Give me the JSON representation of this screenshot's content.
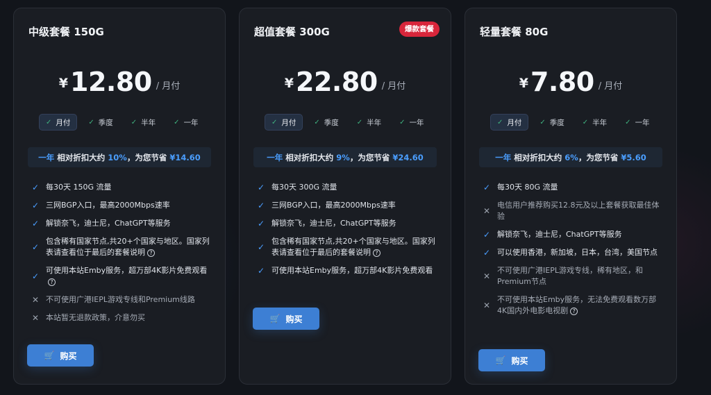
{
  "plans": [
    {
      "title": "中级套餐 150G",
      "badge": "",
      "currency": "¥",
      "price": "12.80",
      "unit": "/ 月付",
      "periods": [
        {
          "label": "月付",
          "active": true
        },
        {
          "label": "季度",
          "active": false
        },
        {
          "label": "半年",
          "active": false
        },
        {
          "label": "一年",
          "active": false
        }
      ],
      "discount": {
        "period": "一年",
        "text1": "相对折扣大约",
        "percent": "10%",
        "text2": "，为您节省",
        "amount": "¥14.60"
      },
      "features": [
        {
          "ok": true,
          "text": "每30天 150G 流量"
        },
        {
          "ok": true,
          "text": "三网BGP入口，最高2000Mbps速率"
        },
        {
          "ok": true,
          "text": "解锁奈飞，迪士尼，ChatGPT等服务"
        },
        {
          "ok": true,
          "text": "包含稀有国家节点,共20+个国家与地区。国家列表请查看位于最后的套餐说明",
          "help": true
        },
        {
          "ok": true,
          "text": "可使用本站Emby服务，超万部4K影片免费观看",
          "help": true
        },
        {
          "ok": false,
          "text": "不可使用广港IEPL游戏专线和Premium线路"
        },
        {
          "ok": false,
          "text": "本站暂无退款政策，介意勿买"
        }
      ],
      "buy_label": "购买"
    },
    {
      "title": "超值套餐 300G",
      "badge": "爆款套餐",
      "currency": "¥",
      "price": "22.80",
      "unit": "/ 月付",
      "periods": [
        {
          "label": "月付",
          "active": true
        },
        {
          "label": "季度",
          "active": false
        },
        {
          "label": "半年",
          "active": false
        },
        {
          "label": "一年",
          "active": false
        }
      ],
      "discount": {
        "period": "一年",
        "text1": "相对折扣大约",
        "percent": "9%",
        "text2": "，为您节省",
        "amount": "¥24.60"
      },
      "features": [
        {
          "ok": true,
          "text": "每30天 300G 流量"
        },
        {
          "ok": true,
          "text": "三网BGP入口，最高2000Mbps速率"
        },
        {
          "ok": true,
          "text": "解锁奈飞，迪士尼，ChatGPT等服务"
        },
        {
          "ok": true,
          "text": "包含稀有国家节点,共20+个国家与地区。国家列表请查看位于最后的套餐说明",
          "help": true
        },
        {
          "ok": true,
          "text": "可使用本站Emby服务，超万部4K影片免费观看"
        }
      ],
      "buy_label": "购买"
    },
    {
      "title": "轻量套餐 80G",
      "badge": "",
      "currency": "¥",
      "price": "7.80",
      "unit": "/ 月付",
      "periods": [
        {
          "label": "月付",
          "active": true
        },
        {
          "label": "季度",
          "active": false
        },
        {
          "label": "半年",
          "active": false
        },
        {
          "label": "一年",
          "active": false
        }
      ],
      "discount": {
        "period": "一年",
        "text1": "相对折扣大约",
        "percent": "6%",
        "text2": "，为您节省",
        "amount": "¥5.60"
      },
      "features": [
        {
          "ok": true,
          "text": "每30天 80G 流量"
        },
        {
          "ok": false,
          "text": "电信用户推荐购买12.8元及以上套餐获取最佳体验"
        },
        {
          "ok": true,
          "text": "解锁奈飞，迪士尼，ChatGPT等服务"
        },
        {
          "ok": true,
          "text": "可以使用香港，新加坡，日本，台湾，美国节点"
        },
        {
          "ok": false,
          "text": "不可使用广港IEPL游戏专线，稀有地区，和Premium节点"
        },
        {
          "ok": false,
          "text": "不可使用本站Emby服务，无法免费观看数万部4K国内外电影电视剧",
          "help": true
        }
      ],
      "buy_label": "购买"
    }
  ]
}
